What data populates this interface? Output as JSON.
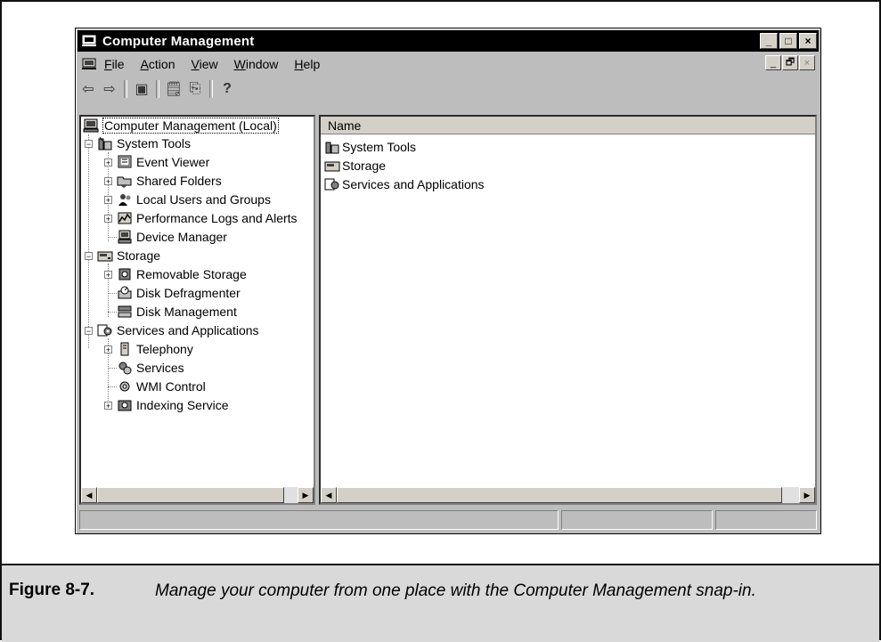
{
  "window": {
    "title": "Computer Management",
    "controls": [
      "_",
      "□",
      "×"
    ],
    "mdi_controls": [
      "_",
      "🗗",
      "×"
    ]
  },
  "menu": {
    "items": [
      {
        "label": "File",
        "accel": "F",
        "rest": "ile"
      },
      {
        "label": "Action",
        "accel": "A",
        "rest": "ction"
      },
      {
        "label": "View",
        "accel": "V",
        "rest": "iew"
      },
      {
        "label": "Window",
        "accel": "W",
        "rest": "indow"
      },
      {
        "label": "Help",
        "accel": "H",
        "rest": "elp"
      }
    ]
  },
  "toolbar": {
    "back": "⇦",
    "forward": "⇨",
    "show_hide_tree": "▣",
    "properties": "🗒",
    "export": "⎘",
    "help": "?"
  },
  "tree": {
    "root": "Computer Management (Local)",
    "system_tools": "System Tools",
    "event_viewer": "Event Viewer",
    "shared_folders": "Shared Folders",
    "local_users": "Local Users and Groups",
    "perf_logs": "Performance Logs and Alerts",
    "device_manager": "Device Manager",
    "storage": "Storage",
    "removable_storage": "Removable Storage",
    "disk_defrag": "Disk Defragmenter",
    "disk_mgmt": "Disk Management",
    "services_apps": "Services and Applications",
    "telephony": "Telephony",
    "services": "Services",
    "wmi_control": "WMI Control",
    "indexing": "Indexing Service"
  },
  "list": {
    "column_name": "Name",
    "items": [
      "System Tools",
      "Storage",
      "Services and Applications"
    ]
  },
  "caption": {
    "label": "Figure 8-7.",
    "text": "Manage your computer from one place with the Computer Management snap-in."
  }
}
